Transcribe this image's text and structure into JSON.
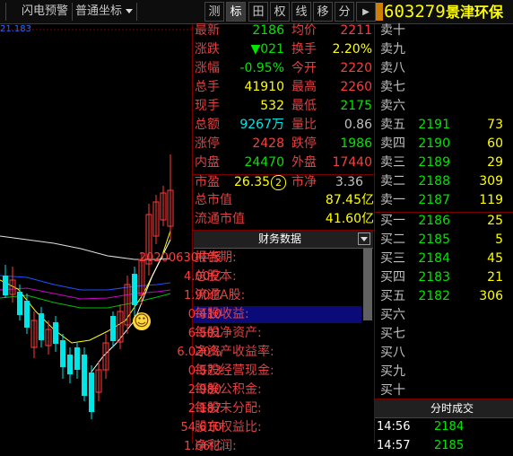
{
  "toolbar": {
    "flash_label": "闪电预警",
    "coord_label": "普通坐标",
    "tabs": [
      "测",
      "标",
      "田",
      "权",
      "线",
      "移",
      "分",
      "▶"
    ],
    "stock_code": "603279",
    "stock_name": "景津环保"
  },
  "chart": {
    "axis_value": "21.183",
    "emoji": "☺"
  },
  "quote": {
    "rows_left": [
      {
        "label": "最新",
        "value": "2186",
        "color": "green"
      },
      {
        "label": "涨跌",
        "value": "▼021",
        "color": "green"
      },
      {
        "label": "涨幅",
        "value": "-0.95%",
        "color": "green"
      },
      {
        "label": "总手",
        "value": "41910",
        "color": "yellow"
      },
      {
        "label": "现手",
        "value": "532",
        "color": "yellow"
      },
      {
        "label": "总额",
        "value": "9267万",
        "color": "cyan"
      },
      {
        "label": "涨停",
        "value": "2428",
        "color": "red"
      },
      {
        "label": "内盘",
        "value": "24470",
        "color": "green"
      }
    ],
    "rows_right": [
      {
        "label": "均价",
        "value": "2211",
        "color": "red"
      },
      {
        "label": "换手",
        "value": "2.20%",
        "color": "yellow"
      },
      {
        "label": "今开",
        "value": "2220",
        "color": "red"
      },
      {
        "label": "最高",
        "value": "2260",
        "color": "red"
      },
      {
        "label": "最低",
        "value": "2175",
        "color": "green"
      },
      {
        "label": "量比",
        "value": "0.86",
        "color": "gray"
      },
      {
        "label": "跌停",
        "value": "1986",
        "color": "green"
      },
      {
        "label": "外盘",
        "value": "17440",
        "color": "red"
      }
    ],
    "pe_label": "市盈",
    "pe_value": "26.35",
    "pe_badge": "2",
    "pb_label": "市净",
    "pb_value": "3.36",
    "total_mv_label": "总市值",
    "total_mv_value": "87.45亿",
    "float_mv_label": "流通市值",
    "float_mv_value": "41.60亿"
  },
  "orderbook": {
    "sell": [
      {
        "label": "卖十",
        "price": "",
        "vol": ""
      },
      {
        "label": "卖九",
        "price": "",
        "vol": ""
      },
      {
        "label": "卖八",
        "price": "",
        "vol": ""
      },
      {
        "label": "卖七",
        "price": "",
        "vol": ""
      },
      {
        "label": "卖六",
        "price": "",
        "vol": ""
      },
      {
        "label": "卖五",
        "price": "2191",
        "vol": "73"
      },
      {
        "label": "卖四",
        "price": "2190",
        "vol": "60"
      },
      {
        "label": "卖三",
        "price": "2189",
        "vol": "29"
      },
      {
        "label": "卖二",
        "price": "2188",
        "vol": "309"
      },
      {
        "label": "卖一",
        "price": "2187",
        "vol": "119"
      }
    ],
    "buy": [
      {
        "label": "买一",
        "price": "2186",
        "vol": "25"
      },
      {
        "label": "买二",
        "price": "2185",
        "vol": "5"
      },
      {
        "label": "买三",
        "price": "2184",
        "vol": "45"
      },
      {
        "label": "买四",
        "price": "2183",
        "vol": "21"
      },
      {
        "label": "买五",
        "price": "2182",
        "vol": "306"
      },
      {
        "label": "买六",
        "price": "",
        "vol": ""
      },
      {
        "label": "买七",
        "price": "",
        "vol": ""
      },
      {
        "label": "买八",
        "price": "",
        "vol": ""
      },
      {
        "label": "买九",
        "price": "",
        "vol": ""
      },
      {
        "label": "买十",
        "price": "",
        "vol": ""
      }
    ]
  },
  "financial": {
    "title": "财务数据",
    "rows": [
      {
        "label": "报告期:",
        "value": "20200630中报"
      },
      {
        "label": "总股本:",
        "value": "4.00亿"
      },
      {
        "label": "流通A股:",
        "value": "1.90亿"
      },
      {
        "label": "每股收益:",
        "value": "0.410"
      },
      {
        "label": "每股净资产:",
        "value": "6.501"
      },
      {
        "label": "净资产收益率:",
        "value": "6.020%"
      },
      {
        "label": "每股经营现金:",
        "value": "0.573"
      },
      {
        "label": "每股公积金:",
        "value": "2.980"
      },
      {
        "label": "每股未分配:",
        "value": "2.187"
      },
      {
        "label": "股东权益比:",
        "value": "54.610"
      },
      {
        "label": "净利润:",
        "value": "1.66亿"
      }
    ]
  },
  "ticks": {
    "title": "分时成交",
    "rows": [
      {
        "time": "14:56",
        "price": "2184"
      },
      {
        "time": "14:57",
        "price": "2185"
      }
    ]
  }
}
